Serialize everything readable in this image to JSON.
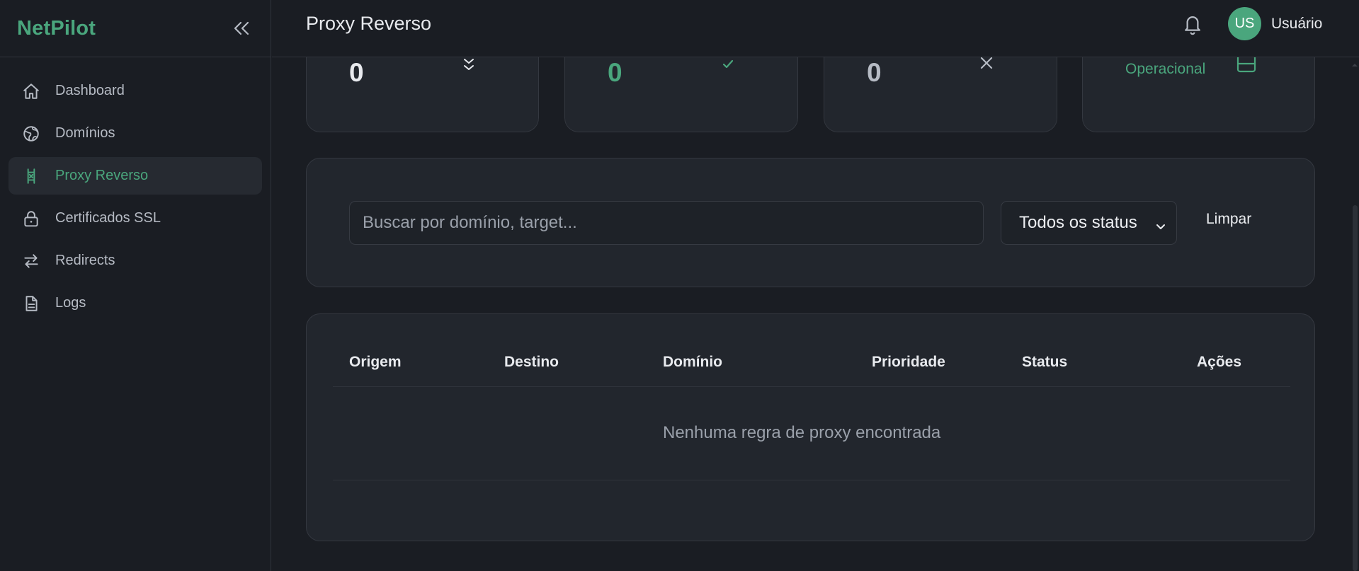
{
  "app": {
    "brand": "NetPilot"
  },
  "sidebar": {
    "items": [
      {
        "label": "Dashboard",
        "icon": "home-icon",
        "active": false
      },
      {
        "label": "Domínios",
        "icon": "globe-icon",
        "active": false
      },
      {
        "label": "Proxy Reverso",
        "icon": "proxy-icon",
        "active": true
      },
      {
        "label": "Certificados SSL",
        "icon": "lock-icon",
        "active": false
      },
      {
        "label": "Redirects",
        "icon": "arrows-swap-icon",
        "active": false
      },
      {
        "label": "Logs",
        "icon": "document-icon",
        "active": false
      }
    ]
  },
  "header": {
    "title": "Proxy Reverso",
    "user": {
      "initials": "US",
      "name": "Usuário"
    }
  },
  "stats": [
    {
      "value": "0",
      "icon": "sort-icon",
      "color": "#e8eaee"
    },
    {
      "value": "0",
      "icon": "check-icon",
      "color": "#4aa67d"
    },
    {
      "value": "0",
      "icon": "x-icon",
      "color": "#b6bbc4"
    },
    {
      "value": "Operacional",
      "icon": "server-icon",
      "color": "#4aa67d"
    }
  ],
  "filters": {
    "search_placeholder": "Buscar por domínio, target...",
    "status_selected": "Todos os status",
    "clear_label": "Limpar"
  },
  "table": {
    "columns": [
      "Origem",
      "Destino",
      "Domínio",
      "Prioridade",
      "Status",
      "Ações"
    ],
    "rows": [],
    "empty_message": "Nenhuma regra de proxy encontrada"
  },
  "colors": {
    "accent": "#4aa67d",
    "background": "#1a1d23",
    "card": "#22262d"
  }
}
